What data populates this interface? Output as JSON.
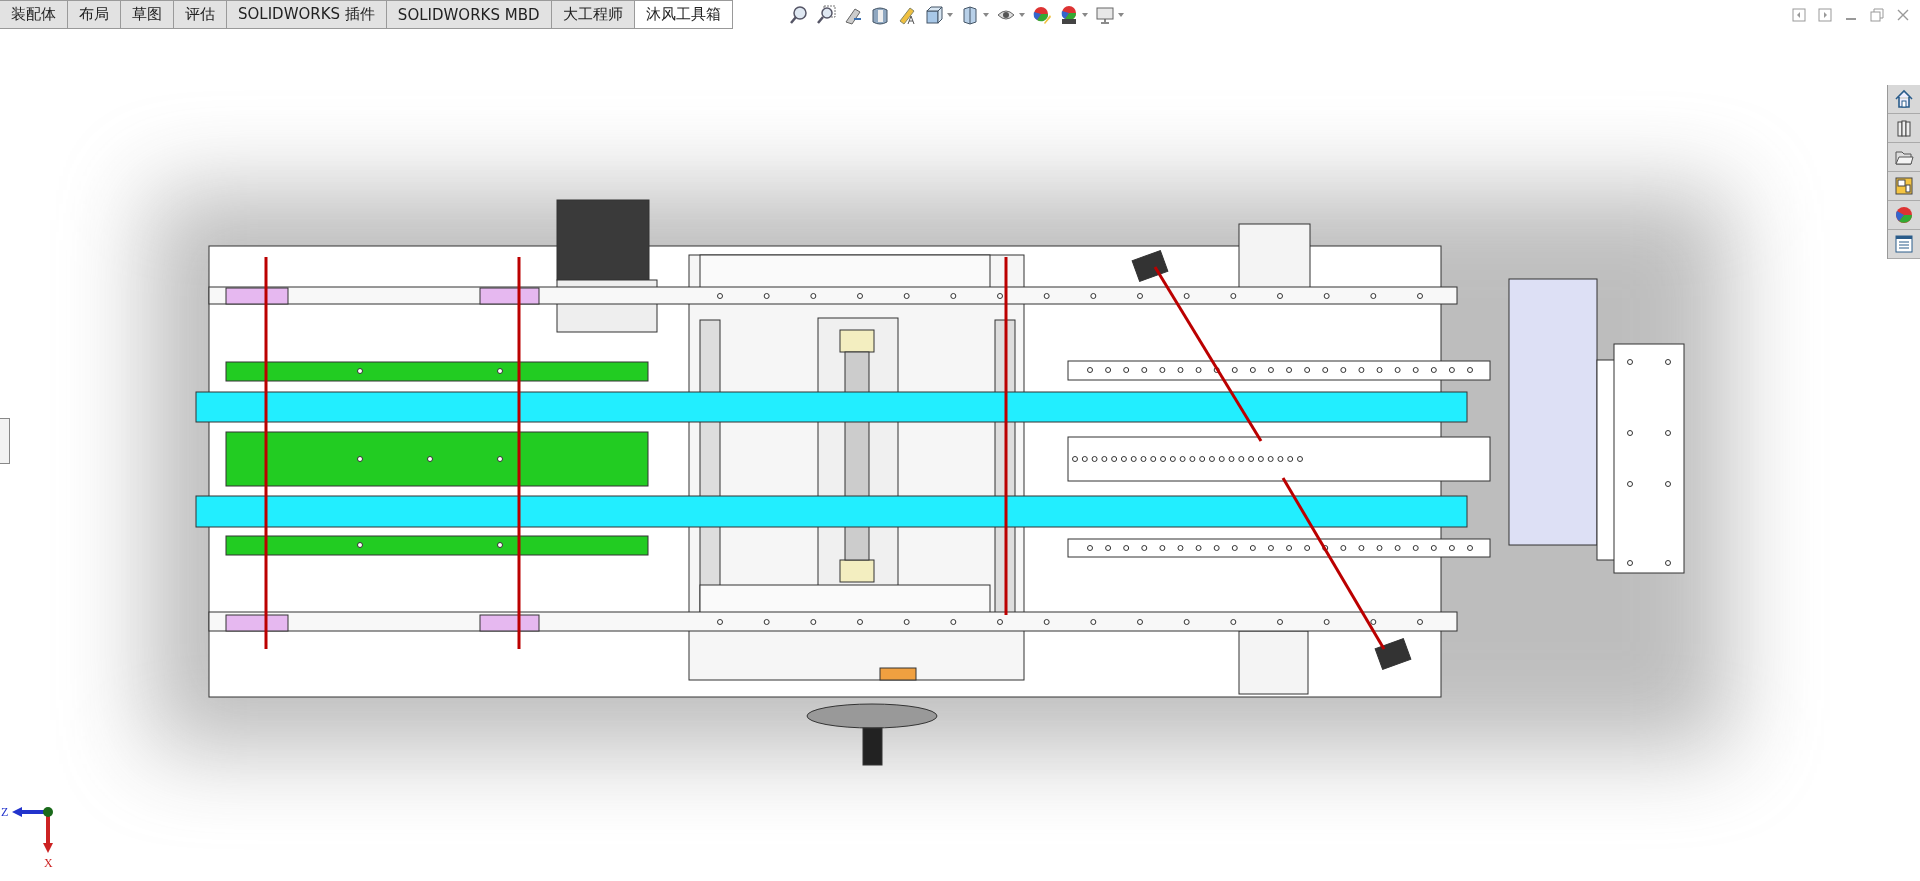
{
  "tabs": [
    {
      "label": "装配体",
      "selected": false
    },
    {
      "label": "布局",
      "selected": false
    },
    {
      "label": "草图",
      "selected": false
    },
    {
      "label": "评估",
      "selected": false
    },
    {
      "label": "SOLIDWORKS 插件",
      "selected": false
    },
    {
      "label": "SOLIDWORKS MBD",
      "selected": false
    },
    {
      "label": "大工程师",
      "selected": false
    },
    {
      "label": "沐风工具箱",
      "selected": true
    }
  ],
  "triad": {
    "axes": [
      {
        "label": "Z",
        "kind": "horizontal"
      },
      {
        "label": "X",
        "kind": "vertical"
      }
    ]
  }
}
